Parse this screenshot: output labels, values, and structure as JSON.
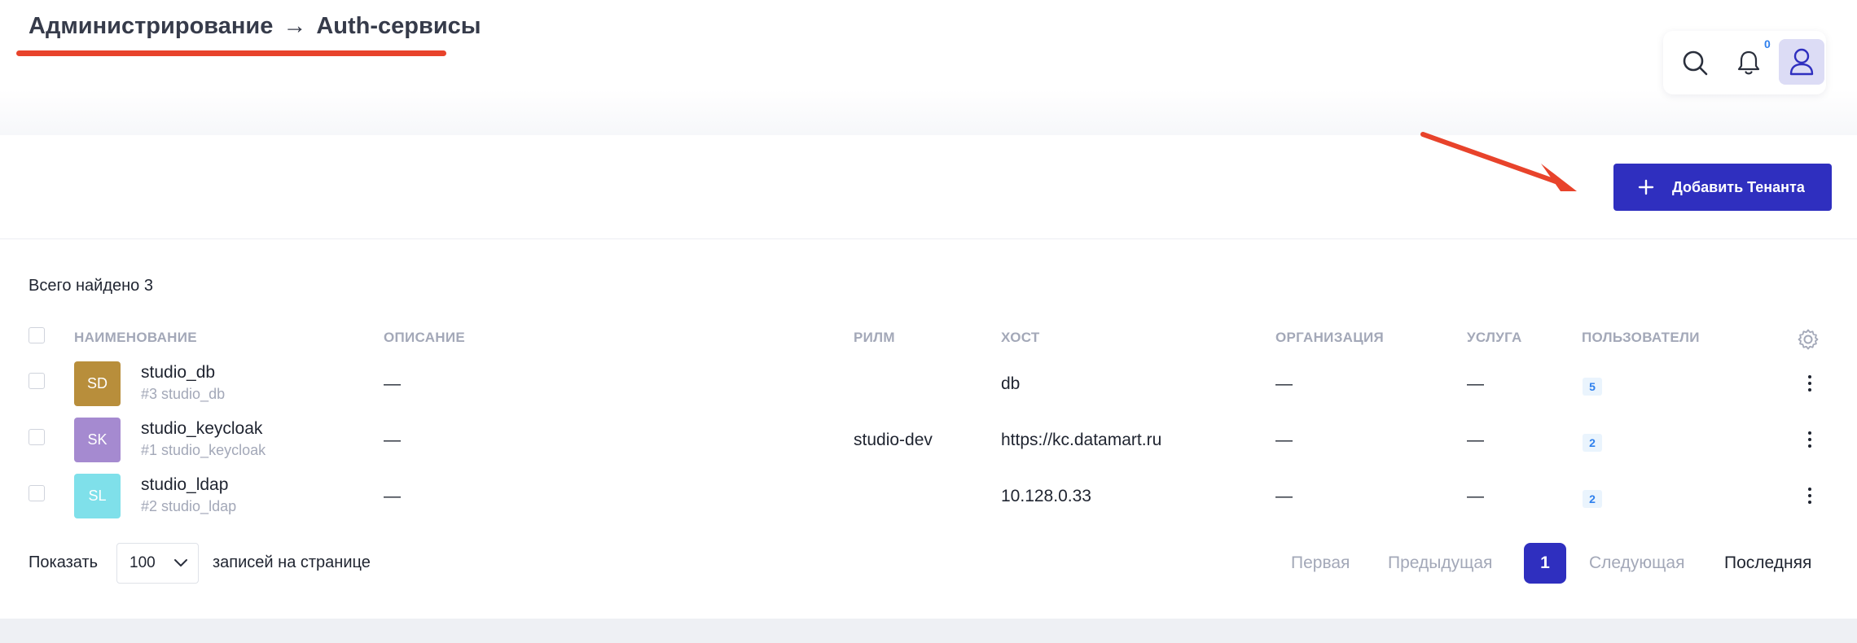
{
  "breadcrumb": {
    "section": "Администрирование",
    "separator": "→",
    "page": "Auth-сервисы"
  },
  "header": {
    "notifications_count": "0",
    "icons": [
      "search-icon",
      "bell-icon",
      "user-icon"
    ]
  },
  "toolbar": {
    "add_label": "Добавить Тенанта",
    "add_icon": "plus-icon"
  },
  "summary": {
    "total_text": "Всего найдено 3"
  },
  "table": {
    "columns": [
      "НАИМЕНОВАНИЕ",
      "ОПИСАНИЕ",
      "РИЛМ",
      "ХОСТ",
      "ОРГАНИЗАЦИЯ",
      "УСЛУГА",
      "ПОЛЬЗОВАТЕЛИ"
    ],
    "rows": [
      {
        "initials": "SD",
        "color": "#b88e3b",
        "name": "studio_db",
        "sub": "#3 studio_db",
        "description": "—",
        "realm": "",
        "host": "db",
        "organization": "—",
        "service": "—",
        "users": "5"
      },
      {
        "initials": "SK",
        "color": "#a58ad0",
        "name": "studio_keycloak",
        "sub": "#1 studio_keycloak",
        "description": "—",
        "realm": "studio-dev",
        "host": "https://kc.datamart.ru",
        "organization": "—",
        "service": "—",
        "users": "2"
      },
      {
        "initials": "SL",
        "color": "#7fe0ea",
        "name": "studio_ldap",
        "sub": "#2 studio_ldap",
        "description": "—",
        "realm": "",
        "host": "10.128.0.33",
        "organization": "—",
        "service": "—",
        "users": "2"
      }
    ]
  },
  "footer": {
    "show_label": "Показать",
    "page_size": "100",
    "per_page_label": "записей на странице",
    "first": "Первая",
    "prev": "Предыдущая",
    "current": "1",
    "next": "Следующая",
    "last": "Последняя"
  },
  "colors": {
    "accent": "#2f2fbf",
    "annotation": "#e8432b",
    "badge": "#2f80ed"
  }
}
